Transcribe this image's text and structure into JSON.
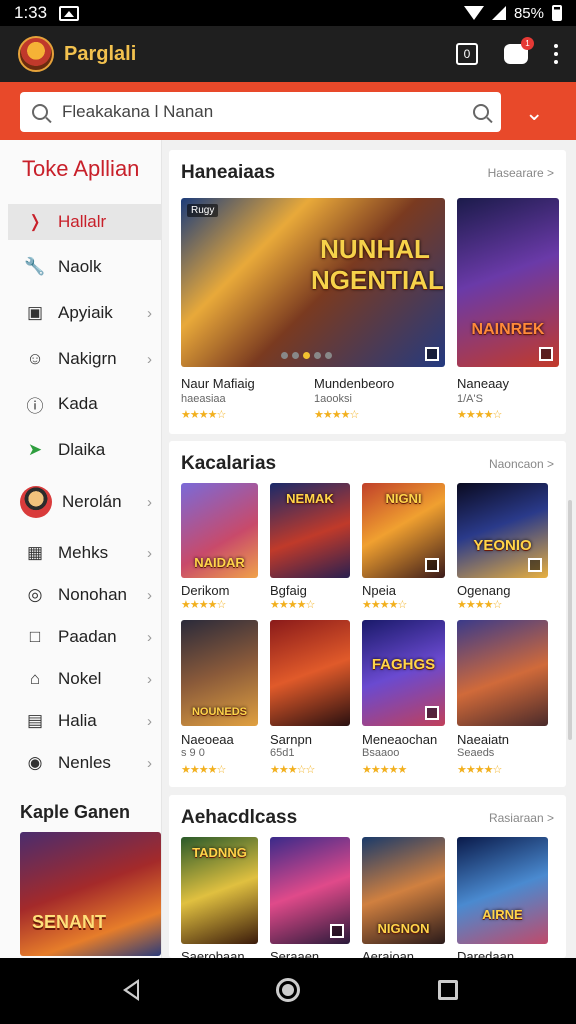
{
  "status_bar": {
    "time": "1:33",
    "battery": "85%"
  },
  "app": {
    "title": "Parglali",
    "chat_badge": "1",
    "box_label": "0"
  },
  "search": {
    "value": "Fleakakana l Nanan"
  },
  "sidebar": {
    "title": "Toke Apllian",
    "items": [
      {
        "label": "Hallalr",
        "icon": "chevron-right-icon",
        "active": true,
        "arrow": false
      },
      {
        "label": "Naolk",
        "icon": "wrench-icon",
        "active": false,
        "arrow": false
      },
      {
        "label": "Apyiaik",
        "icon": "bag-icon",
        "active": false,
        "arrow": true
      },
      {
        "label": "Nakigrn",
        "icon": "user-icon",
        "active": false,
        "arrow": true
      },
      {
        "label": "Kada",
        "icon": "info-icon",
        "active": false,
        "arrow": false
      },
      {
        "label": "Dlaika",
        "icon": "share-icon",
        "active": false,
        "arrow": false
      },
      {
        "label": "Nerolán",
        "icon": "avatar-icon",
        "active": false,
        "arrow": true
      },
      {
        "label": "Mehks",
        "icon": "calendar-icon",
        "active": false,
        "arrow": true
      },
      {
        "label": "Nonohan",
        "icon": "circle-icon",
        "active": false,
        "arrow": true
      },
      {
        "label": "Paadan",
        "icon": "page-icon",
        "active": false,
        "arrow": true
      },
      {
        "label": "Nokel",
        "icon": "home-icon",
        "active": false,
        "arrow": true
      },
      {
        "label": "Halia",
        "icon": "list-icon",
        "active": false,
        "arrow": true
      },
      {
        "label": "Nenles",
        "icon": "gamepad-icon",
        "active": false,
        "arrow": true
      }
    ],
    "promo_title": "Kaple Ganen",
    "promo_text": "SENANT"
  },
  "sections": {
    "featured": {
      "title": "Haneaiaas",
      "more": "Hasearare >",
      "hero_tag": "Rugy",
      "hero_caption": "NUNHAL NGENTIAL",
      "side_caption": "NAINREK",
      "items": [
        {
          "name": "Naur Mafiaig",
          "sub": "haeasiaa",
          "stars": "★★★★☆"
        },
        {
          "name": "Mundenbeoro",
          "sub": "1aooksi",
          "stars": ""
        },
        {
          "name": "Naneaay",
          "sub": "1/A'S",
          "stars": "★★★★☆"
        }
      ]
    },
    "categories": {
      "title": "Kacalarias",
      "more": "Naoncaon >",
      "rows": [
        [
          {
            "name": "Derikom",
            "sub": "",
            "stars": "★★★★☆",
            "cap": "NAIDAR"
          },
          {
            "name": "Bgfaig",
            "sub": "",
            "stars": "★★★★☆",
            "cap": "NEMAK"
          },
          {
            "name": "Npeia",
            "sub": "",
            "stars": "★★★★☆",
            "cap": "NIGNI"
          },
          {
            "name": "Ogenang",
            "sub": "",
            "stars": "★★★★☆",
            "cap": "YEONIO"
          }
        ],
        [
          {
            "name": "Naeoeaa",
            "sub": "s 9 0",
            "stars": "★★★★☆",
            "cap": "NOUNEDS"
          },
          {
            "name": "Sarnpn",
            "sub": "65d1",
            "stars": "★★★☆☆",
            "cap": ""
          },
          {
            "name": "Meneaochan",
            "sub": "Bsaaoo",
            "stars": "★★★★★",
            "cap": "FAGHGS"
          },
          {
            "name": "Naeaiatn",
            "sub": "Seaeds",
            "stars": "★★★★☆",
            "cap": ""
          }
        ]
      ]
    },
    "achievements": {
      "title": "Aehacdlcass",
      "more": "Rasiaraan >",
      "items": [
        {
          "name": "Saerobaan",
          "cap": "TADNNG"
        },
        {
          "name": "Seraaen",
          "cap": ""
        },
        {
          "name": "Aeraioan",
          "cap": "NIGNON"
        },
        {
          "name": "Daredaan",
          "cap": "AIRNE"
        }
      ]
    }
  }
}
